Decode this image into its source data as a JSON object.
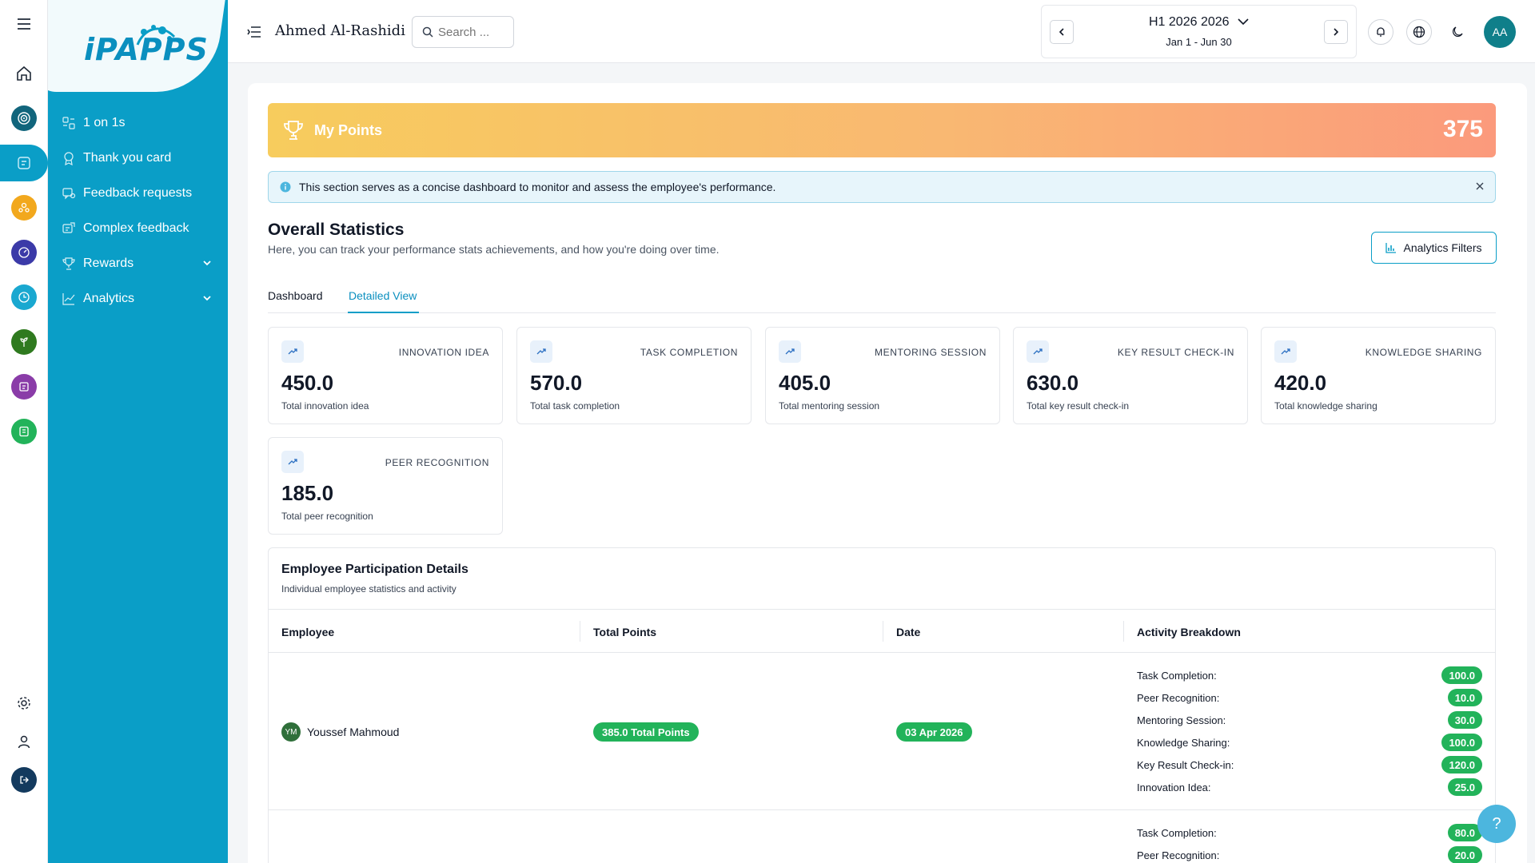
{
  "sidebar": {
    "logo": "iPAPPS",
    "items": [
      {
        "label": "1 on 1s"
      },
      {
        "label": "Thank you card"
      },
      {
        "label": "Feedback requests"
      },
      {
        "label": "Complex feedback"
      },
      {
        "label": "Rewards"
      },
      {
        "label": "Analytics"
      }
    ]
  },
  "header": {
    "user_name": "Ahmed Al-Rashidi",
    "search_placeholder": "Search ...",
    "period_title": "H1 2026 2026",
    "period_range": "Jan 1 - Jun 30",
    "avatar_initials": "AA"
  },
  "points": {
    "label": "My Points",
    "value": "375"
  },
  "info": {
    "text": "This section serves as a concise dashboard to monitor and assess the employee's performance."
  },
  "overall": {
    "title": "Overall Statistics",
    "subtitle": "Here, you can track your performance stats achievements, and how you're doing over time.",
    "filters_label": "Analytics Filters"
  },
  "tabs": [
    {
      "label": "Dashboard"
    },
    {
      "label": "Detailed View"
    }
  ],
  "stats": [
    {
      "label": "INNOVATION IDEA",
      "value": "450.0",
      "desc": "Total innovation idea"
    },
    {
      "label": "TASK COMPLETION",
      "value": "570.0",
      "desc": "Total task completion"
    },
    {
      "label": "MENTORING SESSION",
      "value": "405.0",
      "desc": "Total mentoring session"
    },
    {
      "label": "KEY RESULT CHECK-IN",
      "value": "630.0",
      "desc": "Total key result check-in"
    },
    {
      "label": "KNOWLEDGE SHARING",
      "value": "420.0",
      "desc": "Total knowledge sharing"
    },
    {
      "label": "PEER RECOGNITION",
      "value": "185.0",
      "desc": "Total peer recognition"
    }
  ],
  "participation": {
    "title": "Employee Participation Details",
    "subtitle": "Individual employee statistics and activity",
    "columns": [
      "Employee",
      "Total Points",
      "Date",
      "Activity Breakdown"
    ],
    "rows": [
      {
        "initials": "YM",
        "name": "Youssef Mahmoud",
        "total": "385.0 Total Points",
        "date": "03 Apr 2026",
        "activities": [
          {
            "label": "Task Completion:",
            "value": "100.0"
          },
          {
            "label": "Peer Recognition:",
            "value": "10.0"
          },
          {
            "label": "Mentoring Session:",
            "value": "30.0"
          },
          {
            "label": "Knowledge Sharing:",
            "value": "100.0"
          },
          {
            "label": "Key Result Check-in:",
            "value": "120.0"
          },
          {
            "label": "Innovation Idea:",
            "value": "25.0"
          }
        ]
      },
      {
        "activities": [
          {
            "label": "Task Completion:",
            "value": "80.0"
          },
          {
            "label": "Peer Recognition:",
            "value": "20.0"
          }
        ]
      }
    ]
  },
  "help": "?"
}
